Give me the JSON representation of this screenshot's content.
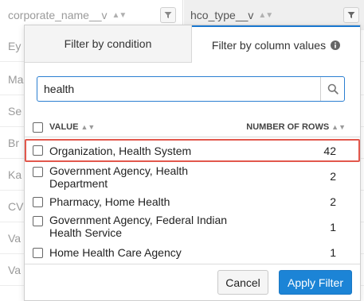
{
  "table": {
    "columns": [
      {
        "label": "corporate_name__v",
        "sort_icon": "sort-arrows-icon",
        "filter_icon": "funnel-icon"
      },
      {
        "label": "hco_type__v",
        "sort_icon": "sort-arrows-icon",
        "filter_icon": "funnel-icon"
      }
    ],
    "rows": [
      {
        "col1": "Ey"
      },
      {
        "col1": "Ma"
      },
      {
        "col1": "Se"
      },
      {
        "col1": "Br"
      },
      {
        "col1": "Ka"
      },
      {
        "col1": "CV"
      },
      {
        "col1": "Va"
      },
      {
        "col1": "Va"
      }
    ]
  },
  "popup": {
    "tabs": [
      {
        "label": "Filter by condition",
        "active": false
      },
      {
        "label": "Filter by column values",
        "active": true,
        "icon": "info-icon"
      }
    ],
    "search": {
      "value": "health",
      "icon": "search-icon"
    },
    "list_header": {
      "value_label": "VALUE",
      "count_label": "NUMBER OF ROWS",
      "sort_icon": "sort-arrows-icon"
    },
    "items": [
      {
        "label": "Organization, Health System",
        "count": "42",
        "checked": false,
        "highlighted": true
      },
      {
        "label": "Government Agency, Health Department",
        "count": "2",
        "checked": false
      },
      {
        "label": "Pharmacy, Home Health",
        "count": "2",
        "checked": false
      },
      {
        "label": "Government Agency, Federal Indian Health Service",
        "count": "1",
        "checked": false
      },
      {
        "label": "Home Health Care Agency",
        "count": "1",
        "checked": false
      }
    ],
    "buttons": {
      "cancel": "Cancel",
      "apply": "Apply Filter"
    }
  },
  "colors": {
    "accent": "#1c84d6",
    "highlight_border": "#e2574c"
  }
}
